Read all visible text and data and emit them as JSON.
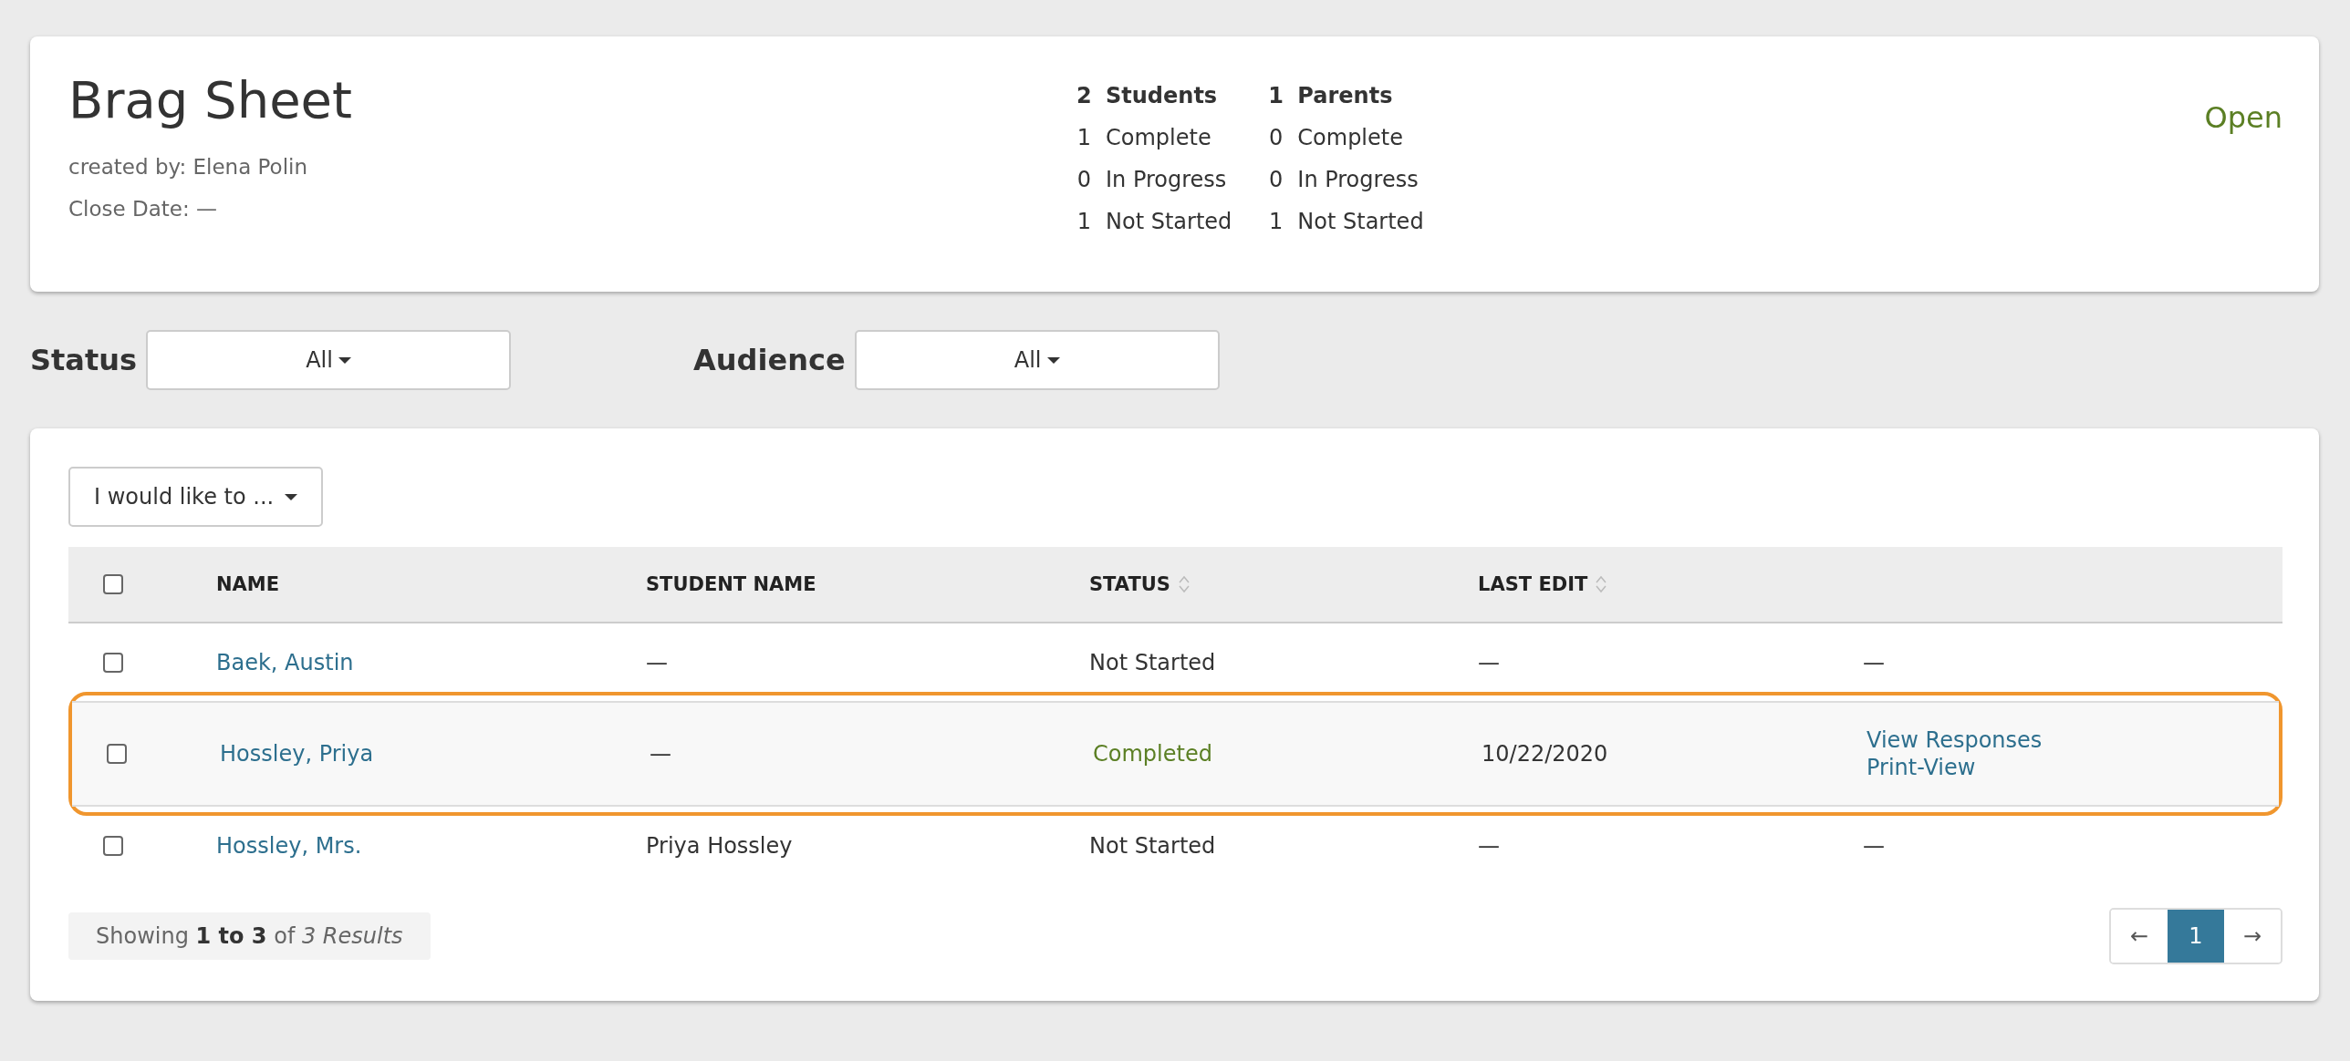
{
  "header": {
    "title": "Brag Sheet",
    "created_by": "created by: Elena Polin",
    "close_date": "Close Date: —",
    "state": "Open",
    "stats": [
      {
        "count": "2",
        "label": "Students",
        "lines": [
          {
            "count": "1",
            "label": "Complete"
          },
          {
            "count": "0",
            "label": "In Progress"
          },
          {
            "count": "1",
            "label": "Not Started"
          }
        ]
      },
      {
        "count": "1",
        "label": "Parents",
        "lines": [
          {
            "count": "0",
            "label": "Complete"
          },
          {
            "count": "0",
            "label": "In Progress"
          },
          {
            "count": "1",
            "label": "Not Started"
          }
        ]
      }
    ]
  },
  "filters": [
    {
      "label": "Status",
      "value": "All"
    },
    {
      "label": "Audience",
      "value": "All"
    }
  ],
  "table": {
    "action_menu": "I would like to ...",
    "select_all_checked": false,
    "columns": [
      {
        "label": "NAME",
        "sortable": false
      },
      {
        "label": "STUDENT NAME",
        "sortable": false
      },
      {
        "label": "STATUS",
        "sortable": true
      },
      {
        "label": "LAST EDIT",
        "sortable": true
      }
    ],
    "rows": [
      {
        "checked": false,
        "highlighted": false,
        "name": "Baek, Austin",
        "student_name": "—",
        "status": "Not Started",
        "kind": "not_started",
        "last_edit": "—",
        "actions": [
          {
            "label": "—",
            "kind": "text"
          }
        ]
      },
      {
        "checked": false,
        "highlighted": true,
        "name": "Hossley, Priya",
        "student_name": "—",
        "status": "Completed",
        "kind": "completed",
        "last_edit": "10/22/2020",
        "actions": [
          {
            "label": "View Responses",
            "kind": "link"
          },
          {
            "label": "Print-View",
            "kind": "link"
          }
        ]
      },
      {
        "checked": false,
        "highlighted": false,
        "name": "Hossley, Mrs.",
        "student_name": "Priya Hossley",
        "status": "Not Started",
        "kind": "not_started",
        "last_edit": "—",
        "actions": [
          {
            "label": "—",
            "kind": "text"
          }
        ]
      }
    ],
    "summary": "Showing **1 to 3** of *3 Results*",
    "pagination": {
      "prev": "←",
      "pages": [
        {
          "label": "1",
          "selected": true
        }
      ],
      "next": "→"
    }
  }
}
